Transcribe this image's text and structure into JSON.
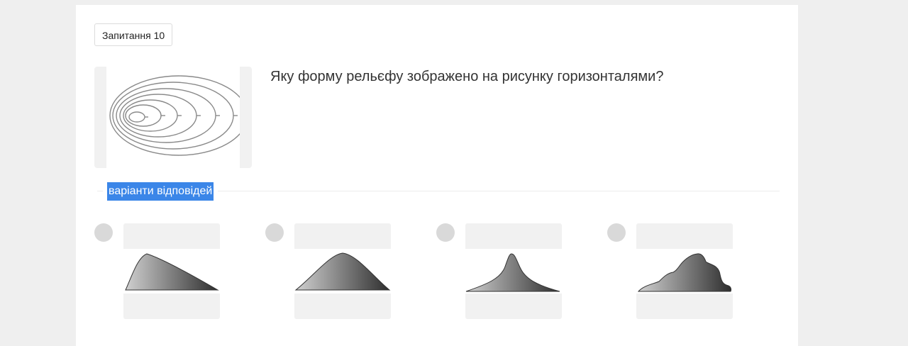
{
  "question": {
    "badge": "Запитання 10",
    "text": "Яку форму рельєфу зображено на рисунку горизонталями?"
  },
  "answers": {
    "label": "варіанти відповідей",
    "options": [
      {
        "image": "gentle-slope-hill-icon"
      },
      {
        "image": "symmetric-hill-icon"
      },
      {
        "image": "steep-peak-mountain-icon"
      },
      {
        "image": "uneven-mountain-icon"
      }
    ]
  },
  "colors": {
    "selection": "#3b86e8",
    "radio": "#d9d9d9",
    "card": "#f1f1f1"
  }
}
